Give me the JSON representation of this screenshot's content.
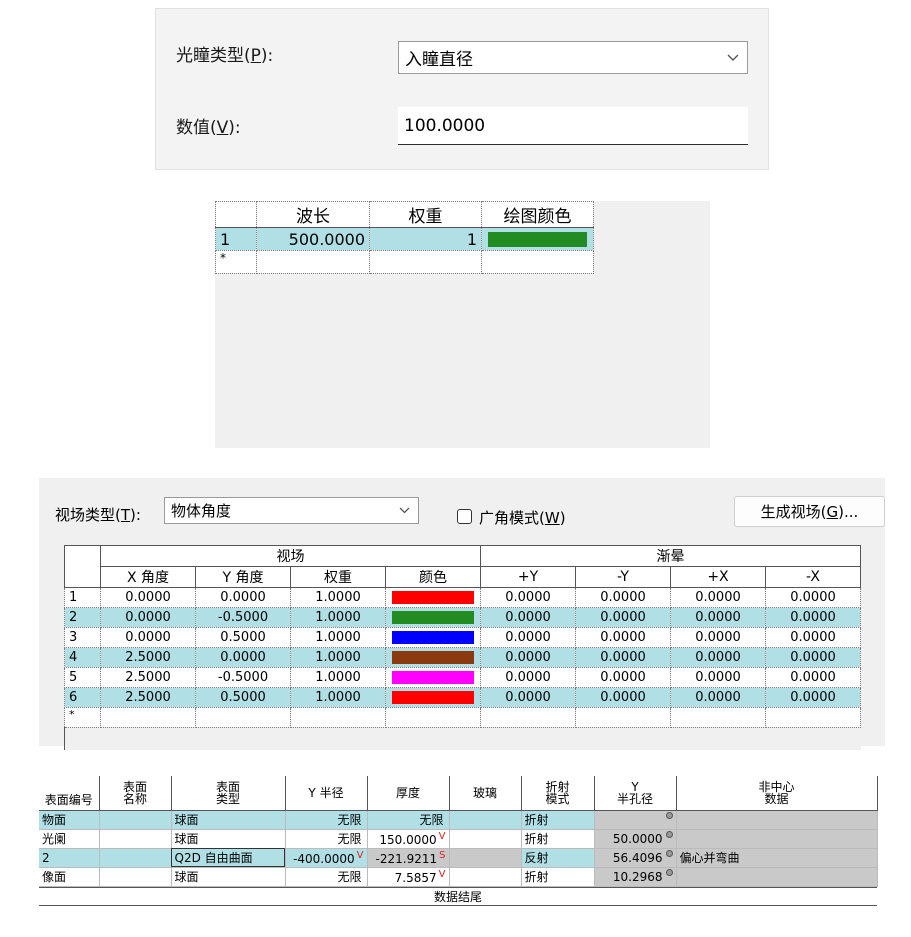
{
  "pupil": {
    "type_label": "光瞳类型(",
    "type_key": "P",
    "type_suffix": "):",
    "type_value": "入瞳直径",
    "value_label": "数值(",
    "value_key": "V",
    "value_suffix": "):",
    "value": "100.0000"
  },
  "wavelength": {
    "headers": [
      "波长",
      "权重",
      "绘图颜色"
    ],
    "rows": [
      {
        "index": "1",
        "wavelength": "500.0000",
        "weight": "1",
        "color": "#228b22"
      }
    ],
    "new_row_marker": "*"
  },
  "field": {
    "type_label": "视场类型(",
    "type_key": "T",
    "type_suffix": "):",
    "type_value": "物体角度",
    "wide_angle_label": "广角模式(",
    "wide_angle_key": "W",
    "wide_angle_suffix": ")",
    "wide_angle_checked": false,
    "generate_label": "生成视场(",
    "generate_key": "G",
    "generate_suffix": ")...",
    "group_field": "视场",
    "group_vignetting": "渐晕",
    "headers": [
      "X 角度",
      "Y 角度",
      "权重",
      "颜色",
      "+Y",
      "-Y",
      "+X",
      "-X"
    ],
    "rows": [
      {
        "index": "1",
        "x": "0.0000",
        "y": "0.0000",
        "w": "1.0000",
        "color": "#ff0000",
        "py": "0.0000",
        "ny": "0.0000",
        "px": "0.0000",
        "nx": "0.0000"
      },
      {
        "index": "2",
        "x": "0.0000",
        "y": "-0.5000",
        "w": "1.0000",
        "color": "#228b22",
        "py": "0.0000",
        "ny": "0.0000",
        "px": "0.0000",
        "nx": "0.0000"
      },
      {
        "index": "3",
        "x": "0.0000",
        "y": "0.5000",
        "w": "1.0000",
        "color": "#0000ff",
        "py": "0.0000",
        "ny": "0.0000",
        "px": "0.0000",
        "nx": "0.0000"
      },
      {
        "index": "4",
        "x": "2.5000",
        "y": "0.0000",
        "w": "1.0000",
        "color": "#8b3a0f",
        "py": "0.0000",
        "ny": "0.0000",
        "px": "0.0000",
        "nx": "0.0000"
      },
      {
        "index": "5",
        "x": "2.5000",
        "y": "-0.5000",
        "w": "1.0000",
        "color": "#ff00ff",
        "py": "0.0000",
        "ny": "0.0000",
        "px": "0.0000",
        "nx": "0.0000"
      },
      {
        "index": "6",
        "x": "2.5000",
        "y": "0.5000",
        "w": "1.0000",
        "color": "#ff0000",
        "py": "0.0000",
        "ny": "0.0000",
        "px": "0.0000",
        "nx": "0.0000"
      }
    ],
    "new_row_marker": "*"
  },
  "surfaces": {
    "headers": [
      "表面编号",
      "表面\n名称",
      "表面\n类型",
      "Y 半径",
      "厚度",
      "玻璃",
      "折射\n模式",
      "Y\n半孔径",
      "非中心\n数据"
    ],
    "rows": [
      {
        "id": "物面",
        "name": "",
        "type": "球面",
        "radius": "无限",
        "radius_flag": "",
        "thickness": "无限",
        "thickness_flag": "",
        "glass": "",
        "mode": "折射",
        "aperture": "",
        "decenter": ""
      },
      {
        "id": "光阑",
        "name": "",
        "type": "球面",
        "radius": "无限",
        "radius_flag": "",
        "thickness": "150.0000",
        "thickness_flag": "V",
        "glass": "",
        "mode": "折射",
        "aperture": "50.0000",
        "decenter": ""
      },
      {
        "id": "2",
        "name": "",
        "type": "Q2D 自由曲面",
        "radius": "-400.0000",
        "radius_flag": "V",
        "thickness": "-221.9211",
        "thickness_flag": "S",
        "glass": "",
        "mode": "反射",
        "aperture": "56.4096",
        "decenter": "偏心并弯曲"
      },
      {
        "id": "像面",
        "name": "",
        "type": "球面",
        "radius": "无限",
        "radius_flag": "",
        "thickness": "7.5857",
        "thickness_flag": "V",
        "glass": "",
        "mode": "折射",
        "aperture": "10.2968",
        "decenter": ""
      }
    ],
    "footer": "数据结尾"
  }
}
